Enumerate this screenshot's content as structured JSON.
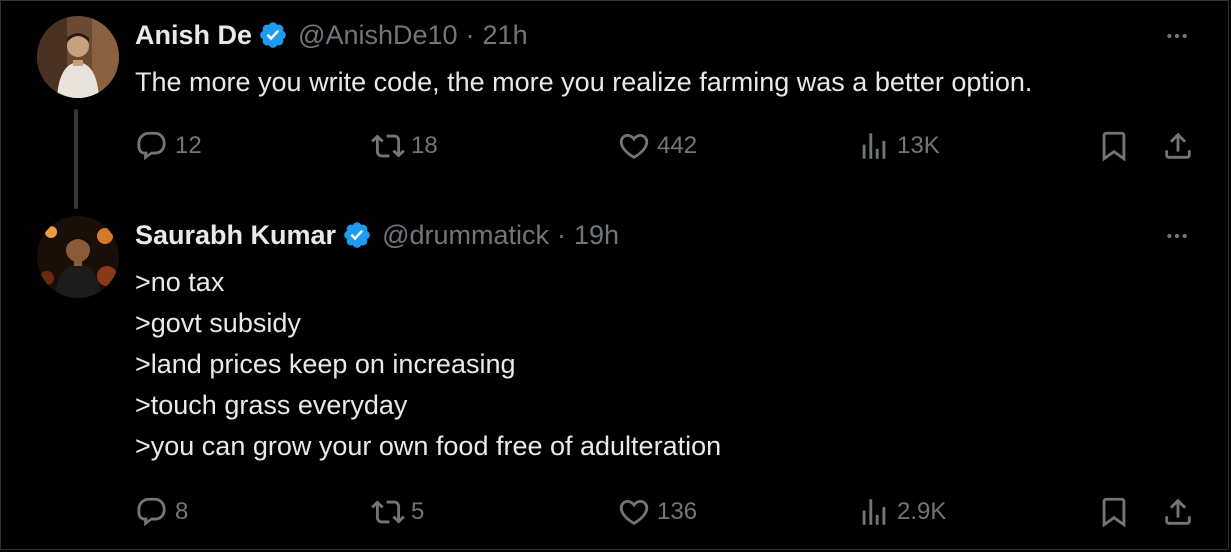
{
  "tweets": [
    {
      "name": "Anish De",
      "handle": "@AnishDe10",
      "separator": "·",
      "time": "21h",
      "text": "The more you write code, the more you realize farming was a better option.",
      "replies": "12",
      "retweets": "18",
      "likes": "442",
      "views": "13K"
    },
    {
      "name": "Saurabh Kumar",
      "handle": "@drummatick",
      "separator": "·",
      "time": "19h",
      "text": ">no tax\n>govt subsidy\n>land prices keep on increasing\n>touch grass everyday\n>you can grow your own food free of adulteration",
      "replies": "8",
      "retweets": "5",
      "likes": "136",
      "views": "2.9K"
    }
  ],
  "icons": {
    "reply": "reply-icon",
    "retweet": "retweet-icon",
    "like": "heart-icon",
    "views": "views-icon",
    "bookmark": "bookmark-icon",
    "share": "share-icon",
    "more": "more-dots-icon",
    "verified": "verified-badge-icon"
  },
  "colors": {
    "background": "#000000",
    "text": "#e7e9ea",
    "muted": "#71767b",
    "verified": "#1d9bf0",
    "thread_line": "#333639"
  }
}
